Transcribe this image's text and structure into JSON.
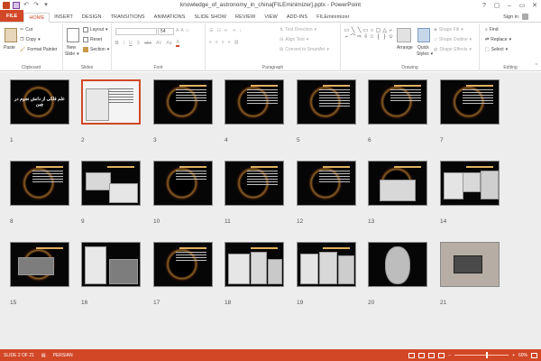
{
  "window": {
    "title": "knowledge_of_astronomy_in_china[FILEminimizer].pptx - PowerPoint",
    "controls": [
      "?",
      "▢",
      "–",
      "▭",
      "✕"
    ]
  },
  "tabs": [
    "FILE",
    "HOME",
    "INSERT",
    "DESIGN",
    "TRANSITIONS",
    "ANIMATIONS",
    "SLIDE SHOW",
    "REVIEW",
    "VIEW",
    "ADD-INS",
    "FILEminimizer"
  ],
  "active_tab": "HOME",
  "account": {
    "signin": "Sign in"
  },
  "ribbon": {
    "clipboard": {
      "label": "Clipboard",
      "paste": "Paste",
      "cut": "Cut",
      "copy": "Copy",
      "format_painter": "Format Painter"
    },
    "slides": {
      "label": "Slides",
      "new_slide": "New",
      "new_slide2": "Slide",
      "layout": "Layout",
      "reset": "Reset",
      "section": "Section"
    },
    "font": {
      "label": "Font",
      "font_name": "",
      "font_size": "54"
    },
    "paragraph": {
      "label": "Paragraph",
      "text_direction": "Text Direction",
      "align_text": "Align Text",
      "convert": "Convert to SmartArt"
    },
    "drawing": {
      "label": "Drawing",
      "arrange": "Arrange",
      "quick_styles": "Quick",
      "quick_styles2": "Styles",
      "shape_fill": "Shape Fill",
      "shape_outline": "Shape Outline",
      "shape_effects": "Shape Effects"
    },
    "editing": {
      "label": "Editing",
      "find": "Find",
      "replace": "Replace",
      "select": "Select"
    }
  },
  "slides": [
    {
      "n": "1",
      "title": "علم فلکی از دانش نجوم در چین"
    },
    {
      "n": "2"
    },
    {
      "n": "3"
    },
    {
      "n": "4"
    },
    {
      "n": "5"
    },
    {
      "n": "6"
    },
    {
      "n": "7"
    },
    {
      "n": "8"
    },
    {
      "n": "9"
    },
    {
      "n": "10"
    },
    {
      "n": "11"
    },
    {
      "n": "12"
    },
    {
      "n": "13"
    },
    {
      "n": "14"
    },
    {
      "n": "15"
    },
    {
      "n": "16"
    },
    {
      "n": "17"
    },
    {
      "n": "18"
    },
    {
      "n": "19"
    },
    {
      "n": "20"
    },
    {
      "n": "21"
    }
  ],
  "selected_slide": "2",
  "status": {
    "slide_info": "SLIDE 2 OF 21",
    "language": "PERSIAN",
    "zoom": "60%",
    "zoom_fraction": 0.6
  },
  "colors": {
    "accent": "#d24726",
    "sorter_bg": "#ededed"
  }
}
